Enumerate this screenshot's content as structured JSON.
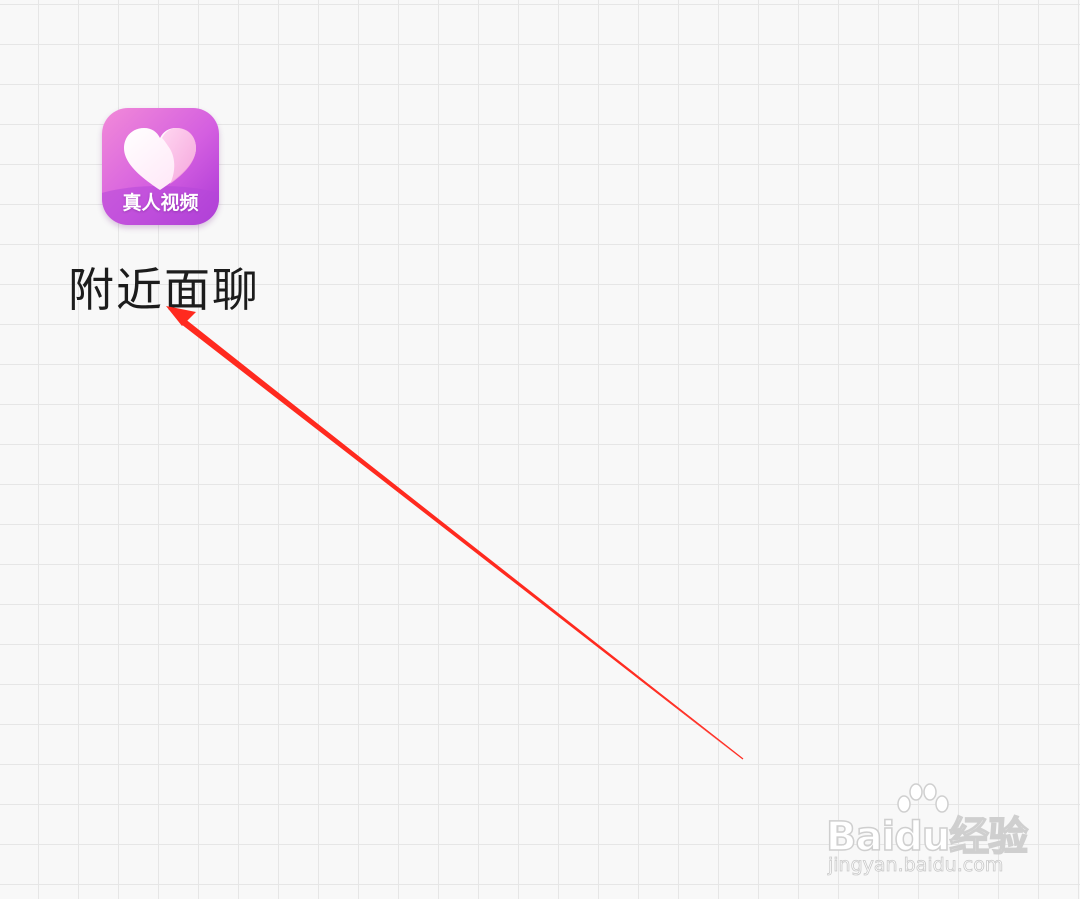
{
  "app": {
    "icon_name": "heart-icon",
    "icon_caption": "真人视频",
    "label": "附近面聊",
    "colors": {
      "icon_gradient_start": "#f07fd0",
      "icon_gradient_end": "#b23fd8",
      "heart": "#ffffff"
    }
  },
  "annotation": {
    "type": "arrow",
    "color": "#ff2a1f"
  },
  "watermark": {
    "logo_text": "Baidu经验",
    "url_text": "jingyan.baidu.com",
    "icon_name": "paw-icon"
  }
}
